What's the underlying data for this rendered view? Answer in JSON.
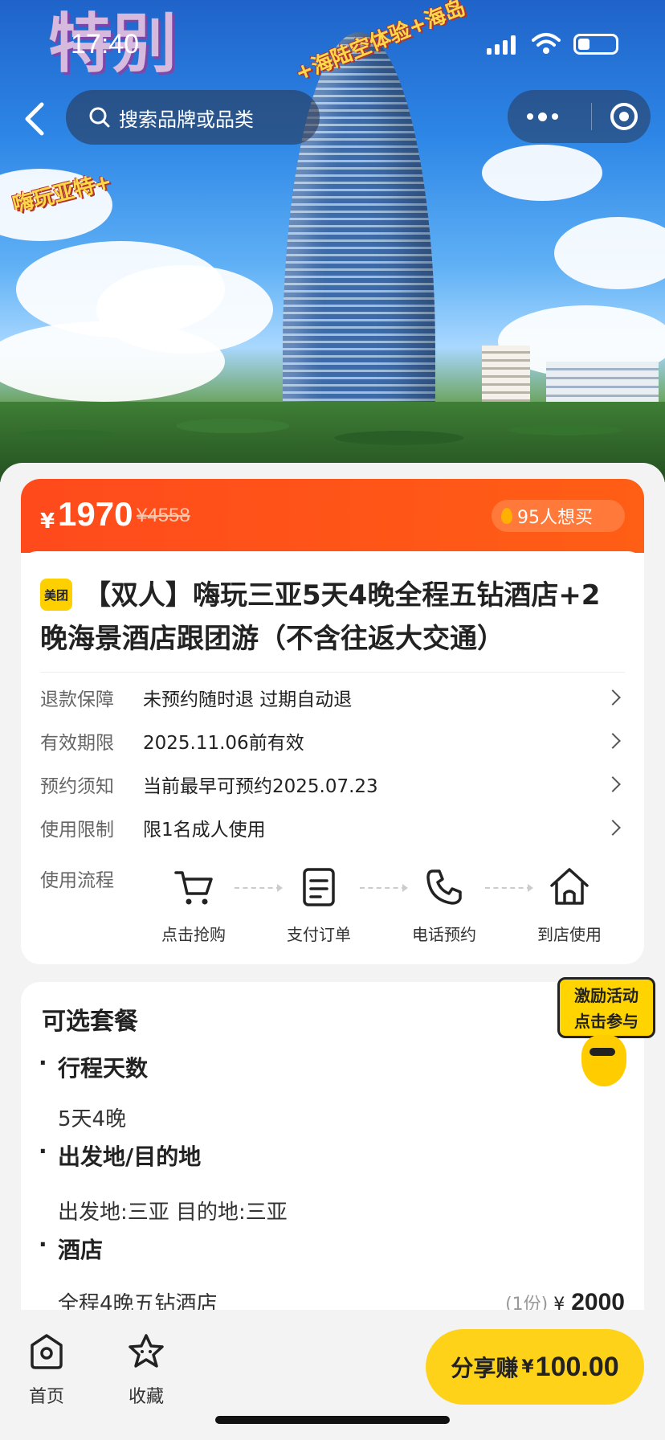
{
  "status_bar": {
    "time": "17:40"
  },
  "search": {
    "placeholder": "搜索品牌或品类"
  },
  "price": {
    "currency": "¥",
    "current": "1970",
    "original": "¥4558",
    "want_count": "95人想买"
  },
  "product": {
    "brand_badge": "美团",
    "title": "【双人】嗨玩三亚5天4晚全程五钻酒店+2晚海景酒店跟团游（不含往返大交通）"
  },
  "info_rows": [
    {
      "key": "退款保障",
      "value": "未预约随时退 过期自动退"
    },
    {
      "key": "有效期限",
      "value": "2025.11.06前有效"
    },
    {
      "key": "预约须知",
      "value": "当前最早可预约2025.07.23"
    },
    {
      "key": "使用限制",
      "value": "限1名成人使用"
    }
  ],
  "flow": {
    "label": "使用流程",
    "steps": [
      {
        "label": "点击抢购",
        "icon": "cart-icon"
      },
      {
        "label": "支付订单",
        "icon": "document-icon"
      },
      {
        "label": "电话预约",
        "icon": "phone-icon"
      },
      {
        "label": "到店使用",
        "icon": "store-icon"
      }
    ]
  },
  "packages": {
    "title": "可选套餐",
    "sections": [
      {
        "heading": "行程天数",
        "value": "5天4晚"
      },
      {
        "heading": "出发地/目的地",
        "value": "出发地:三亚 目的地:三亚"
      },
      {
        "heading": "酒店",
        "value": "全程4晚五钻酒店"
      }
    ],
    "hotel_qty": "(1份)",
    "hotel_currency": "¥",
    "hotel_price": "2000"
  },
  "promo": {
    "line1": "激励活动",
    "line2": "点击参与"
  },
  "bottom_bar": {
    "home": "首页",
    "favorite": "收藏",
    "share_label": "分享赚",
    "share_currency": "¥",
    "share_amount": "100.00"
  },
  "hero_banner": {
    "big_text": "特别",
    "line_a": "嗨玩亚特+",
    "line_b": "+海陆空体验+海岛"
  },
  "colors": {
    "accent_orange": "#ff4a1c",
    "share_yellow": "#ffd21a",
    "brand_yellow": "#ffd000"
  }
}
